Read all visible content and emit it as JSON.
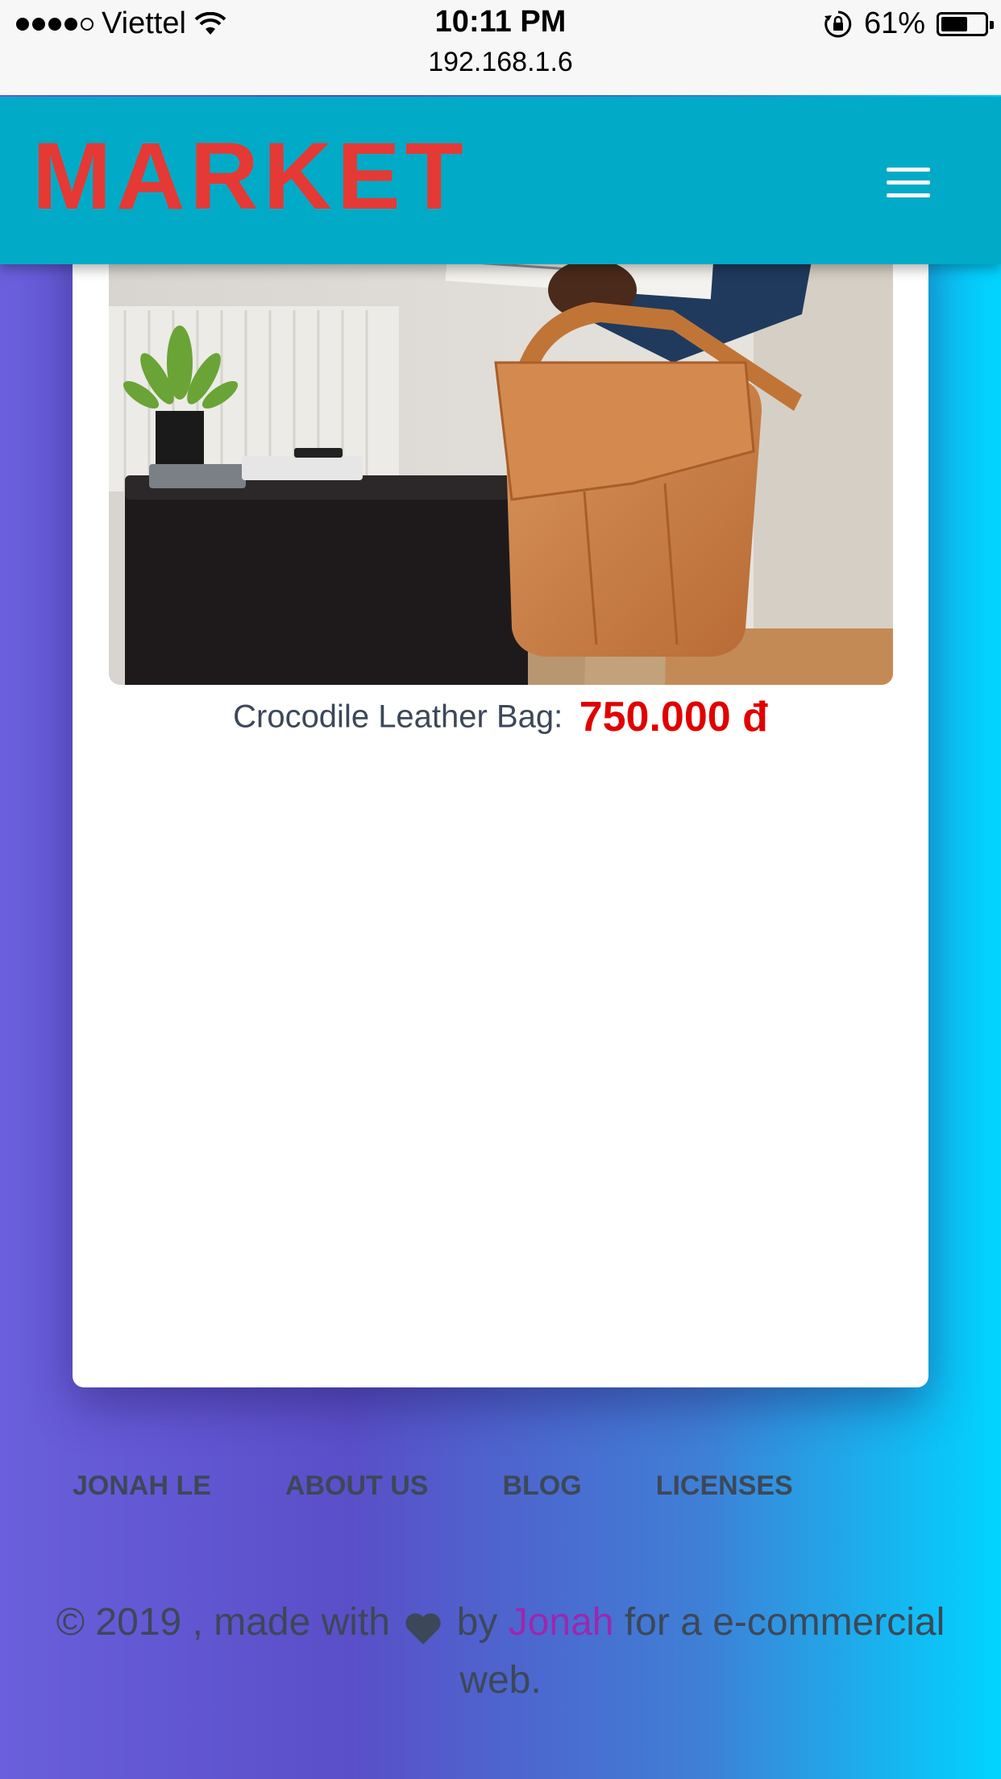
{
  "status_bar": {
    "carrier": "Viettel",
    "time": "10:11 PM",
    "url": "192.168.1.6",
    "battery": "61%",
    "battery_level": 0.61
  },
  "navbar": {
    "brand": "MARKET",
    "menu_icon": "hamburger-icon"
  },
  "product": {
    "name": "Crocodile Leather Bag:",
    "price": "750.000 đ"
  },
  "footer": {
    "links": [
      "JONAH LE",
      "ABOUT US",
      "BLOG",
      "LICENSES"
    ],
    "copyright_prefix": "© 2019 , made with",
    "copyright_by": "by",
    "author": "Jonah",
    "copyright_suffix": "for a e-commercial web."
  },
  "colors": {
    "navbar": "#01aac7",
    "brand": "#e53935",
    "price": "#e00000",
    "author": "#9c27b0"
  }
}
